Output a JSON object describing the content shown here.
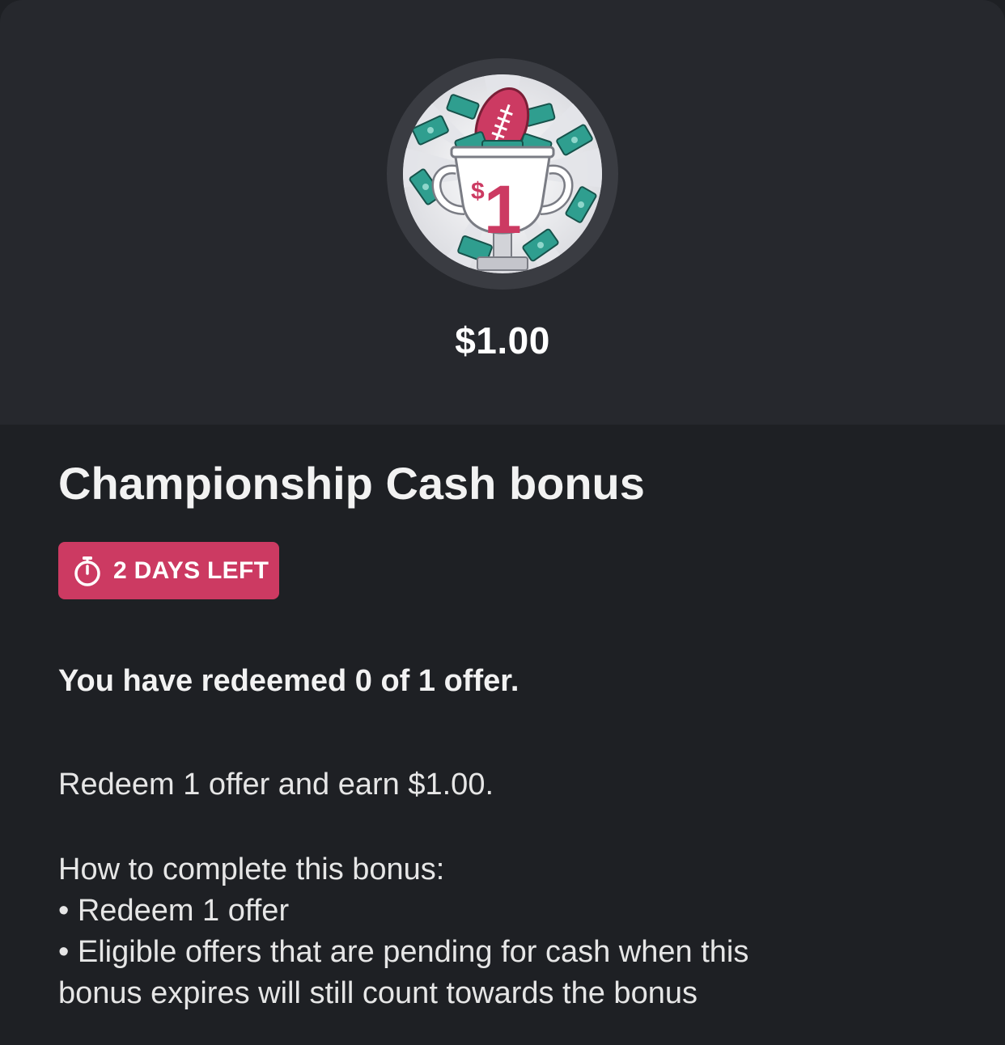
{
  "bonus": {
    "amount": "$1.00",
    "badge_value": "1",
    "badge_currency": "$",
    "title": "Championship Cash bonus",
    "timer_label": "2 DAYS LEFT",
    "redeemed_text": "You have redeemed 0 of 1 offer.",
    "description": "Redeem 1 offer and earn $1.00.",
    "howto_heading": "How to complete this bonus:",
    "howto_items": [
      "• Redeem 1 offer",
      "• Eligible offers that are pending for cash when this",
      "bonus expires will still count towards the bonus"
    ]
  },
  "icons": {
    "badge": "trophy-football-cash-icon",
    "timer": "stopwatch-icon"
  },
  "colors": {
    "background": "#1e2024",
    "hero_background": "#26282d",
    "accent": "#cc3a62",
    "cash_green": "#2f9e8f"
  }
}
